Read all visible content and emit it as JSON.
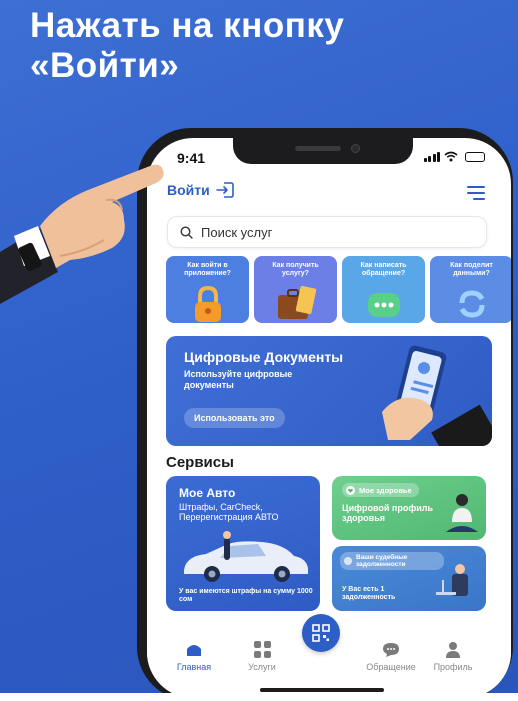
{
  "headline": {
    "line1": "Нажать на кнопку",
    "line2": "«Войти»"
  },
  "status": {
    "time": "9:41"
  },
  "header": {
    "login_label": "Войти"
  },
  "search": {
    "placeholder": "Поиск услуг"
  },
  "stories": [
    {
      "label": "Как войти в приложение?",
      "color": "#4d7fe0",
      "icon": "padlock-icon"
    },
    {
      "label": "Как получить услугу?",
      "color": "#6b7fe6",
      "icon": "briefcase-icon"
    },
    {
      "label": "Как написать обращение?",
      "color": "#5aa7e8",
      "icon": "chat-bubble-icon"
    },
    {
      "label": "Как поделит данными?",
      "color": "#5b8de4",
      "icon": "sync-icon"
    }
  ],
  "banner": {
    "title": "Цифровые Документы",
    "subtitle": "Используйте цифровые документы",
    "button_label": "Использовать это"
  },
  "services": {
    "title": "Сервисы",
    "auto": {
      "title": "Мое Авто",
      "subtitle": "Штрафы, CarCheck, Перерегистрация АВТО",
      "footer": "У вас имеются штрафы на сумму 1000 сом"
    },
    "health": {
      "pill": "Мое здоровье",
      "text": "Цифровой профиль здоровья"
    },
    "court": {
      "pill": "Ваши судебные задолженности",
      "footer": "У Вас есть 1 задолженность"
    }
  },
  "tabbar": {
    "home": "Главная",
    "services": "Услуги",
    "appeal": "Обращение",
    "profile": "Профиль"
  },
  "colors": {
    "accent": "#2d5ec8",
    "poster_bg": "#2f5fc9",
    "health": "#5cc07c"
  }
}
